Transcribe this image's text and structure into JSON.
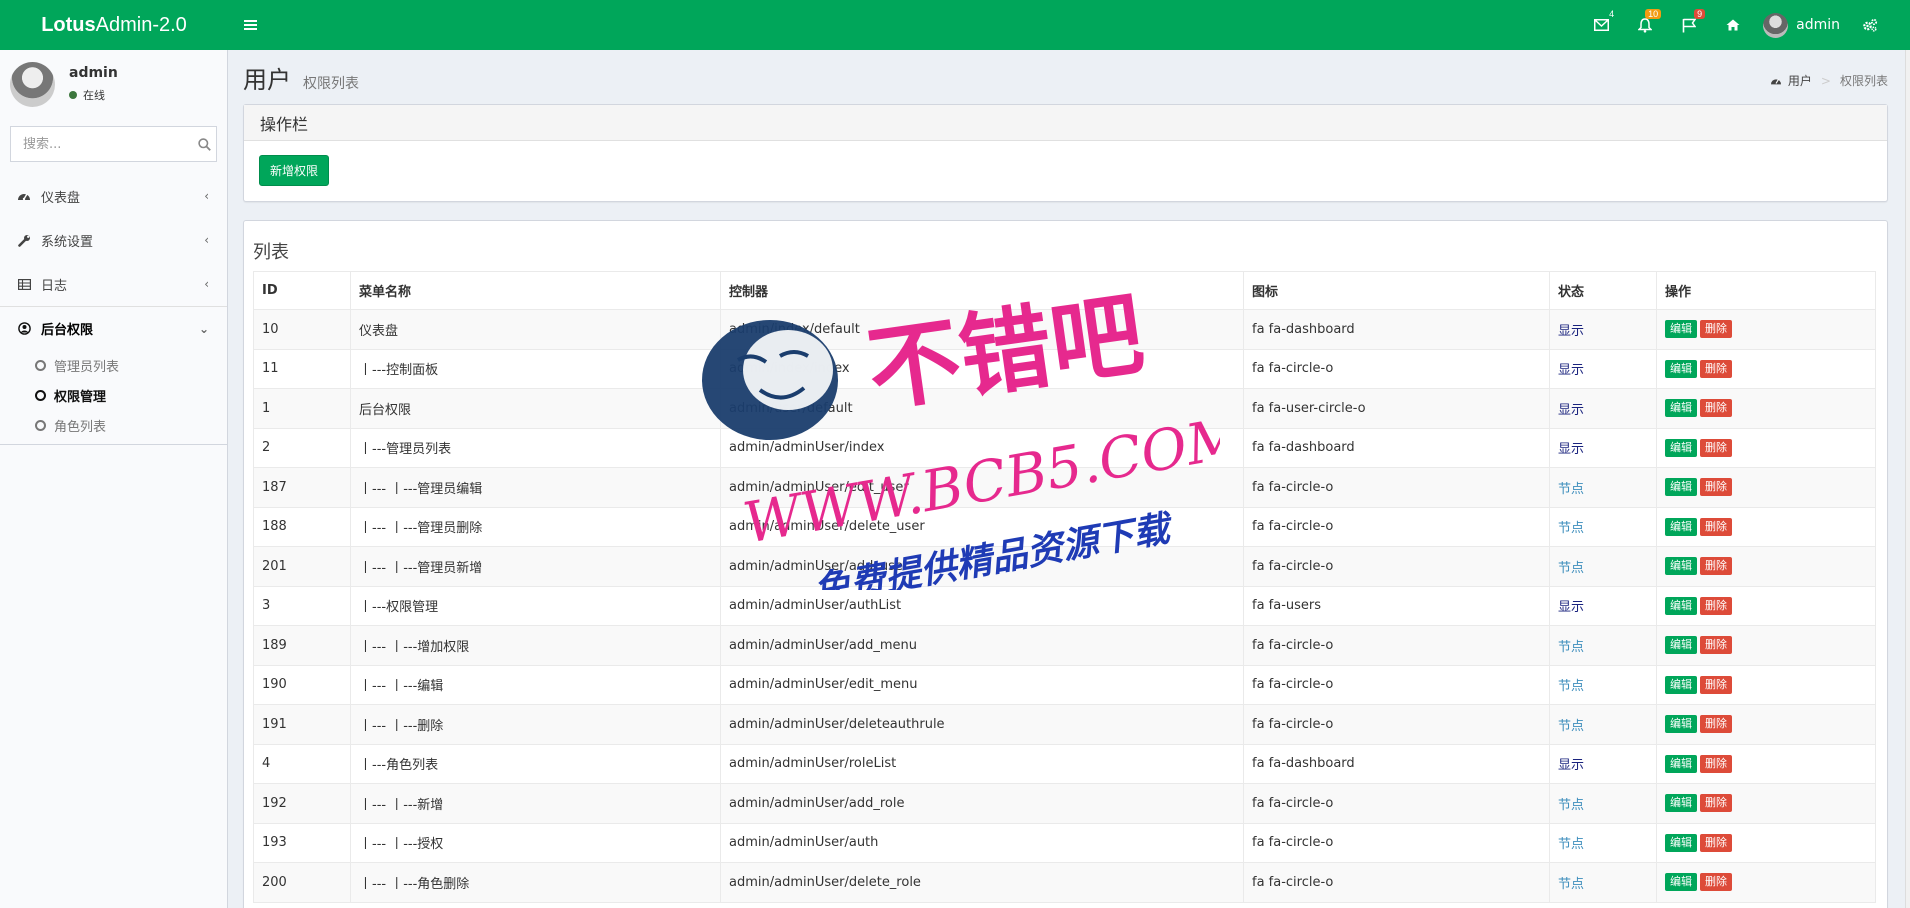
{
  "header": {
    "logo_bold": "Lotus",
    "logo_rest": "Admin-2.0",
    "badges": {
      "mail": "4",
      "bell": "10",
      "flag": "9"
    },
    "user_name": "admin"
  },
  "sidebar": {
    "user_name": "admin",
    "user_status": "在线",
    "search_placeholder": "搜索...",
    "menu": [
      {
        "label": "仪表盘"
      },
      {
        "label": "系统设置"
      },
      {
        "label": "日志"
      },
      {
        "label": "后台权限"
      }
    ],
    "submenu": [
      {
        "label": "管理员列表"
      },
      {
        "label": "权限管理"
      },
      {
        "label": "角色列表"
      }
    ]
  },
  "content": {
    "title": "用户",
    "subtitle": "权限列表",
    "breadcrumb": {
      "home": "用户",
      "current": "权限列表"
    },
    "op_box_title": "操作栏",
    "add_button": "新增权限",
    "list_title": "列表",
    "columns": [
      "ID",
      "菜单名称",
      "控制器",
      "图标",
      "状态",
      "操作"
    ],
    "edit_label": "编辑",
    "delete_label": "删除",
    "rows": [
      {
        "id": "10",
        "name": "仪表盘",
        "controller": "admin/index/default",
        "icon": "fa fa-dashboard",
        "status": "显示"
      },
      {
        "id": "11",
        "name": "丨---控制面板",
        "controller": "admin/index/index",
        "icon": "fa fa-circle-o",
        "status": "显示"
      },
      {
        "id": "1",
        "name": "后台权限",
        "controller": "admin/user/default",
        "icon": "fa fa-user-circle-o",
        "status": "显示"
      },
      {
        "id": "2",
        "name": "丨---管理员列表",
        "controller": "admin/adminUser/index",
        "icon": "fa fa-dashboard",
        "status": "显示"
      },
      {
        "id": "187",
        "name": "丨--- 丨---管理员编辑",
        "controller": "admin/adminUser/edit_user",
        "icon": "fa fa-circle-o",
        "status": "节点"
      },
      {
        "id": "188",
        "name": "丨--- 丨---管理员删除",
        "controller": "admin/adminUser/delete_user",
        "icon": "fa fa-circle-o",
        "status": "节点"
      },
      {
        "id": "201",
        "name": "丨--- 丨---管理员新增",
        "controller": "admin/adminUser/add_user",
        "icon": "fa fa-circle-o",
        "status": "节点"
      },
      {
        "id": "3",
        "name": "丨---权限管理",
        "controller": "admin/adminUser/authList",
        "icon": "fa fa-users",
        "status": "显示"
      },
      {
        "id": "189",
        "name": "丨--- 丨---增加权限",
        "controller": "admin/adminUser/add_menu",
        "icon": "fa fa-circle-o",
        "status": "节点"
      },
      {
        "id": "190",
        "name": "丨--- 丨---编辑",
        "controller": "admin/adminUser/edit_menu",
        "icon": "fa fa-circle-o",
        "status": "节点"
      },
      {
        "id": "191",
        "name": "丨--- 丨---删除",
        "controller": "admin/adminUser/deleteauthrule",
        "icon": "fa fa-circle-o",
        "status": "节点"
      },
      {
        "id": "4",
        "name": "丨---角色列表",
        "controller": "admin/adminUser/roleList",
        "icon": "fa fa-dashboard",
        "status": "显示"
      },
      {
        "id": "192",
        "name": "丨--- 丨---新增",
        "controller": "admin/adminUser/add_role",
        "icon": "fa fa-circle-o",
        "status": "节点"
      },
      {
        "id": "193",
        "name": "丨--- 丨---授权",
        "controller": "admin/adminUser/auth",
        "icon": "fa fa-circle-o",
        "status": "节点"
      },
      {
        "id": "200",
        "name": "丨--- 丨---角色删除",
        "controller": "admin/adminUser/delete_role",
        "icon": "fa fa-circle-o",
        "status": "节点"
      }
    ]
  },
  "watermark": {
    "title": "不错吧",
    "url": "WWW.BCB5.COM",
    "slogan": "免费提供精品资源下载"
  },
  "colors": {
    "brand": "#00a65a",
    "danger": "#dd4b39",
    "status_show": "#1a237e",
    "status_node": "#3c8dbc",
    "watermark_pink": "#e6298e",
    "watermark_blue": "#1f3bb5"
  }
}
